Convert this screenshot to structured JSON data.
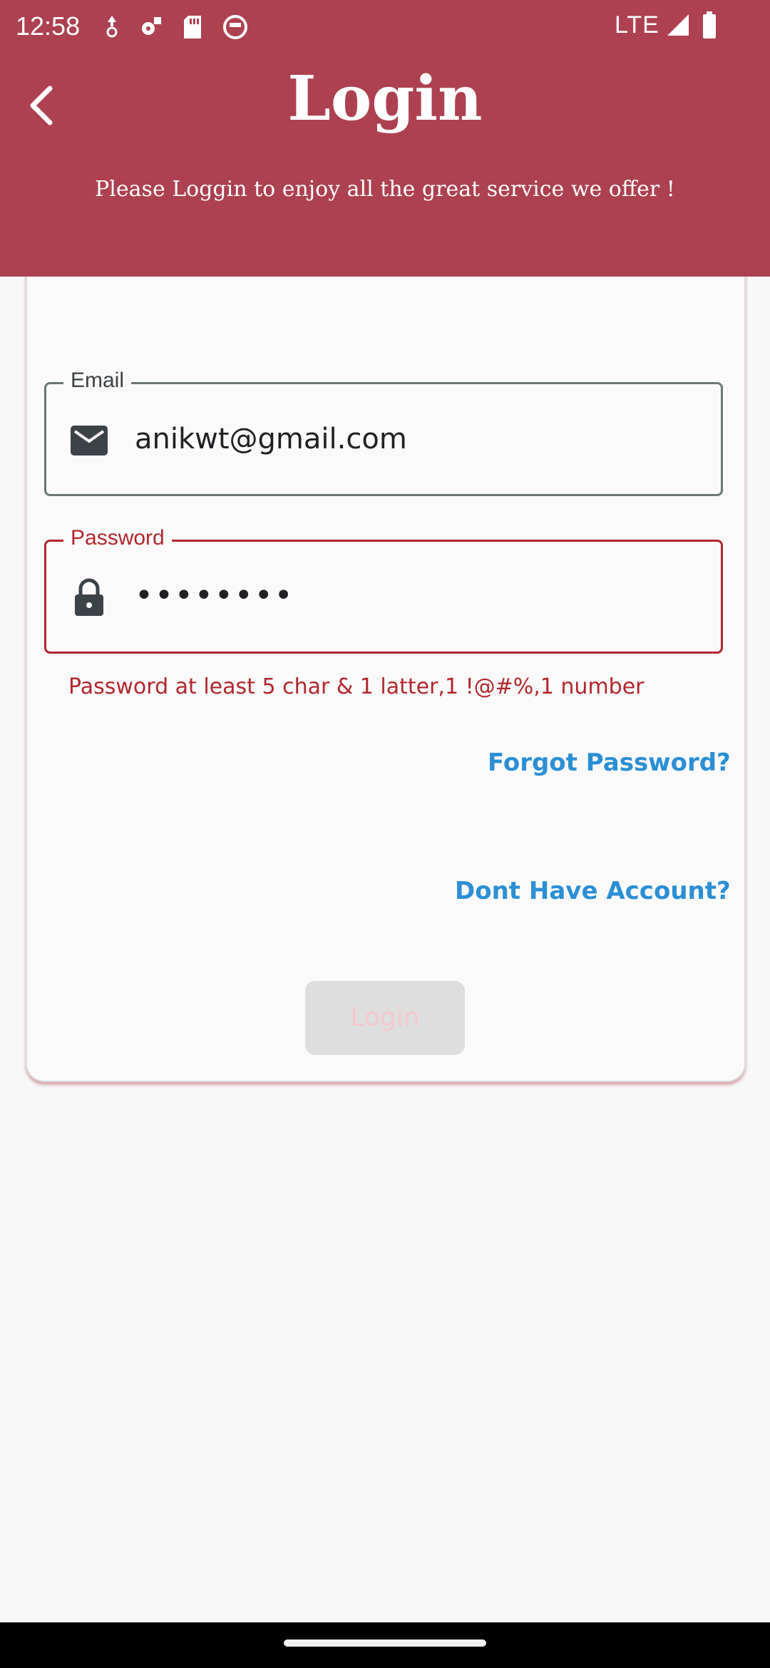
{
  "status_bar": {
    "time": "12:58",
    "network": "LTE"
  },
  "header": {
    "title": "Login",
    "subtitle": "Please Loggin to enjoy all the great service we offer !"
  },
  "form": {
    "email": {
      "label": "Email",
      "value": "anikwt@gmail.com",
      "icon": "mail-icon"
    },
    "password": {
      "label": "Password",
      "value": "••••••••",
      "icon": "lock-icon",
      "error": "Password at least 5 char & 1 latter,1 !@#%,1 number"
    },
    "forgot_link": "Forgot Password?",
    "signup_link": "Dont Have Account?",
    "login_button": "Login"
  },
  "colors": {
    "header": "#ad414f",
    "error": "#b3262d",
    "link": "#2b8fd6"
  }
}
